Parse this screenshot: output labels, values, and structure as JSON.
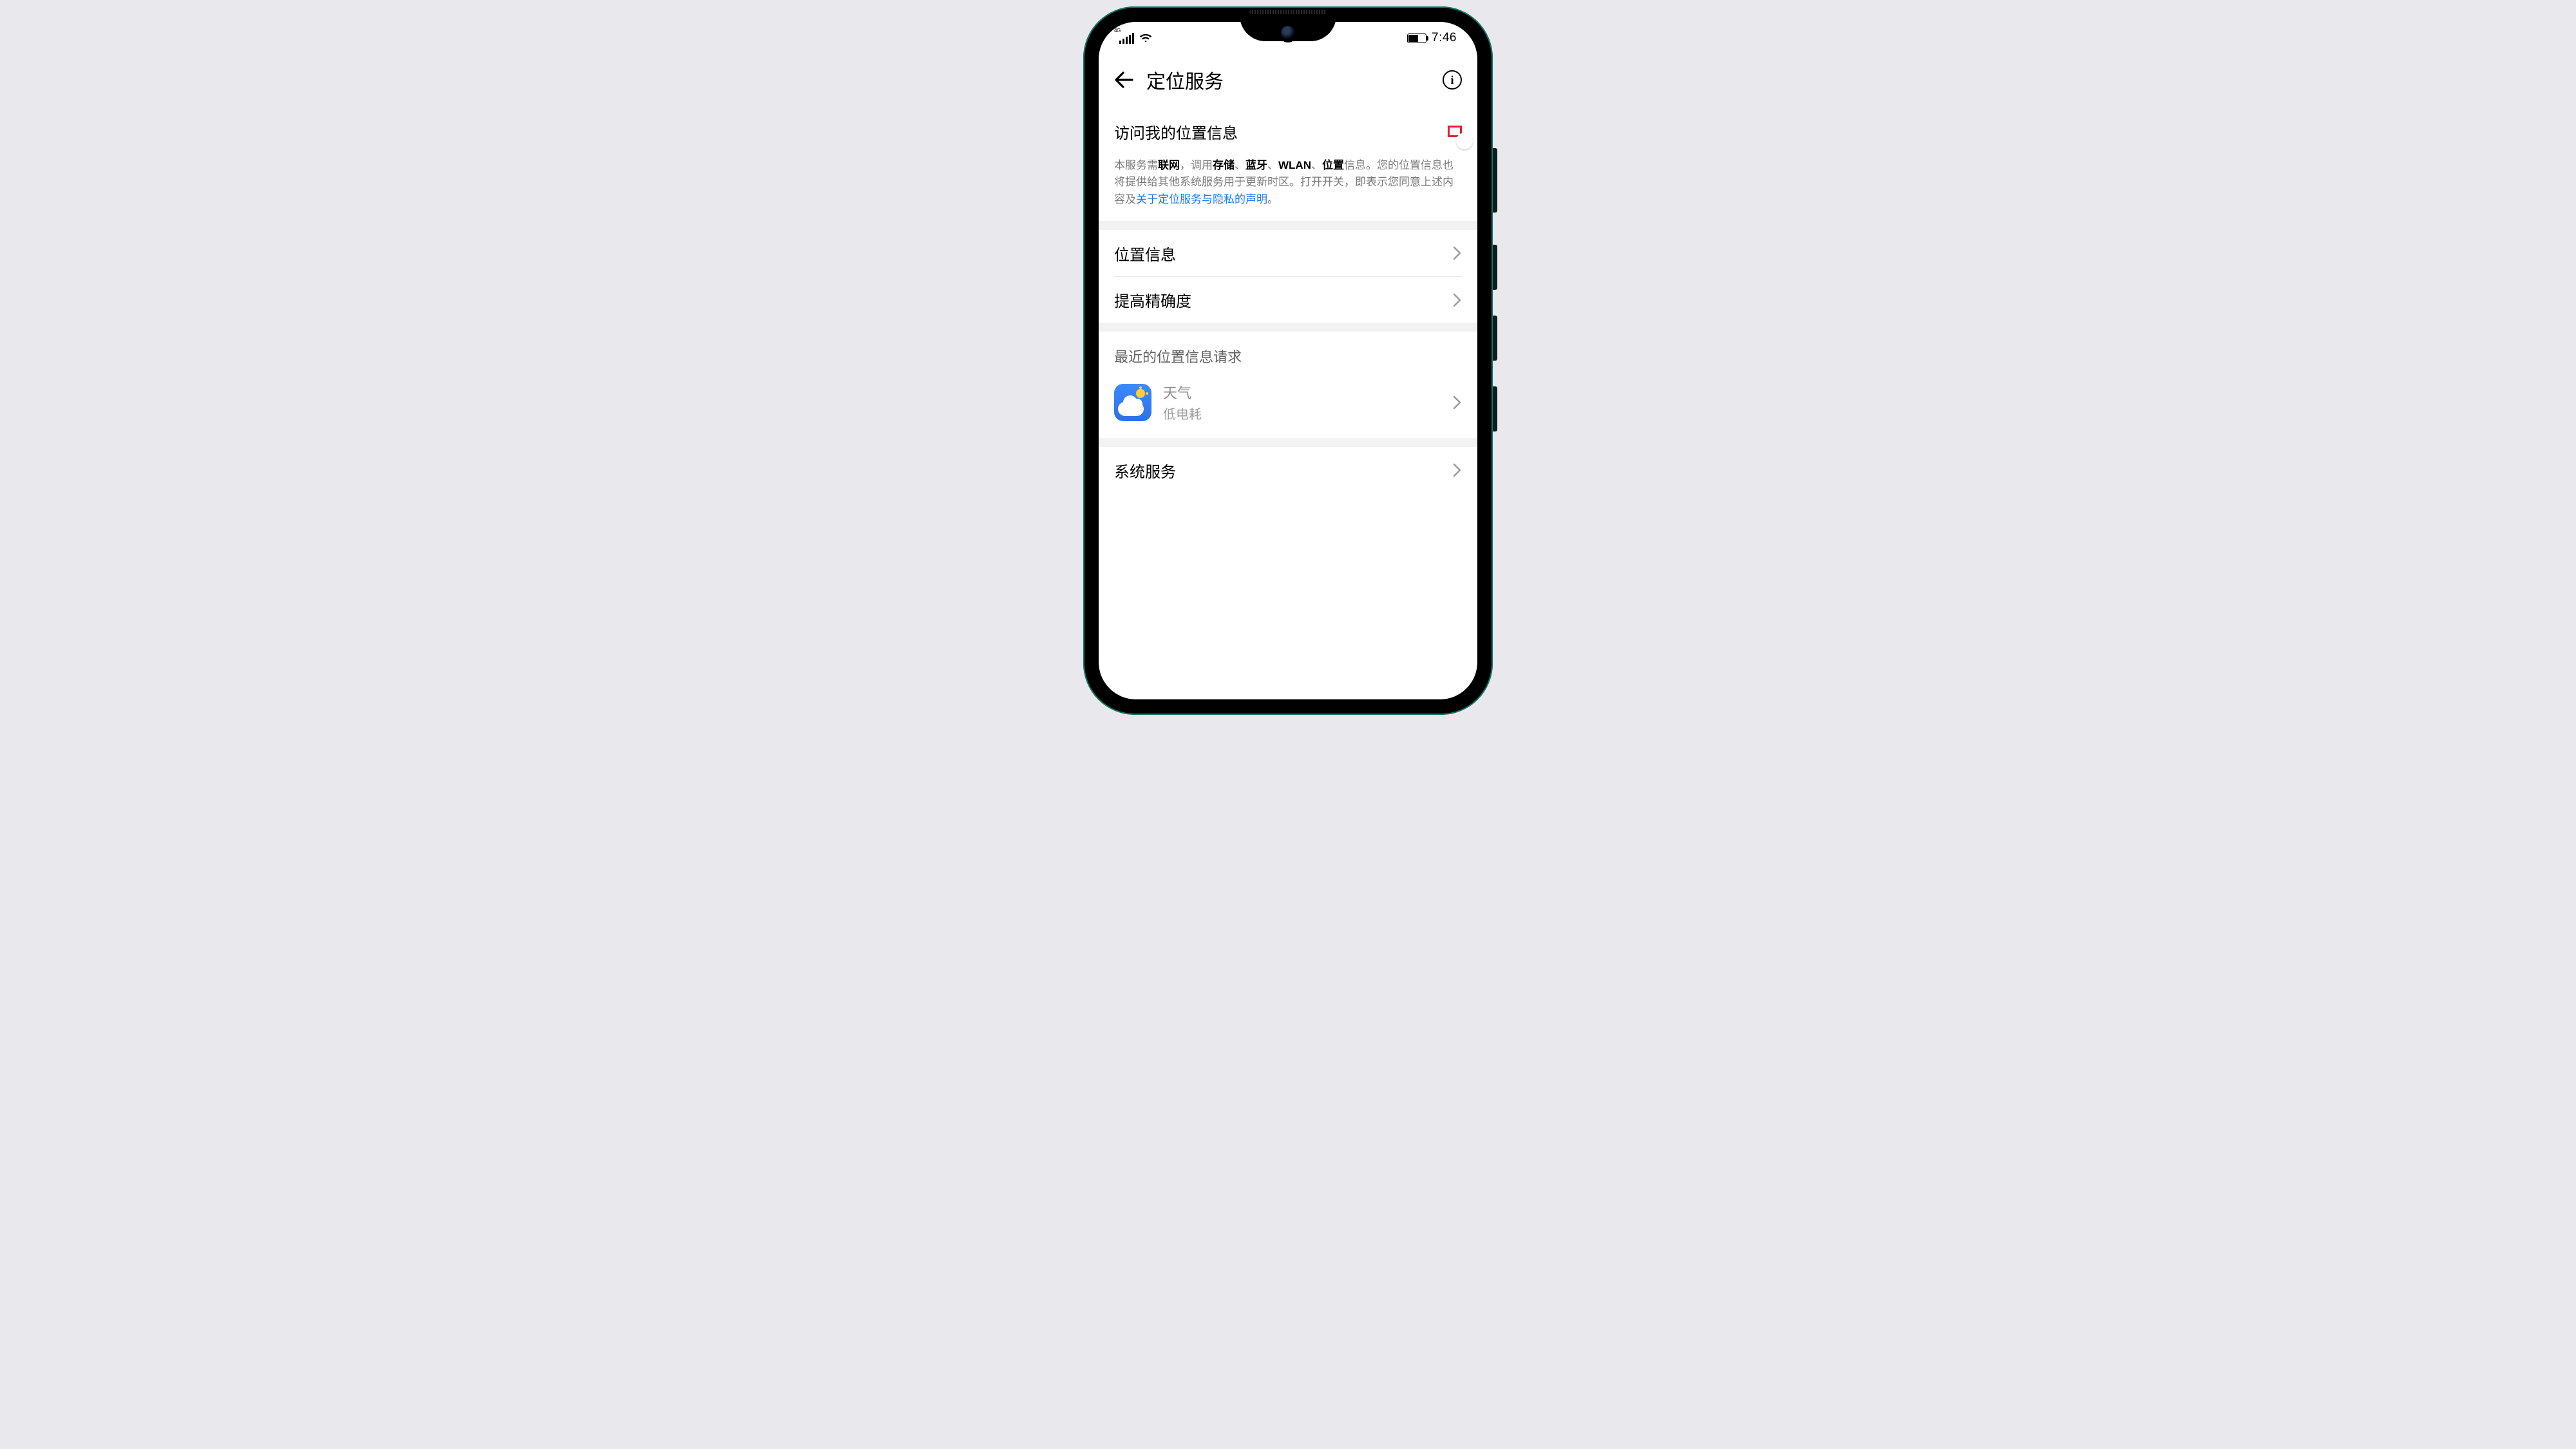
{
  "status": {
    "network_label": "4G",
    "time": "7:46"
  },
  "header": {
    "title": "定位服务"
  },
  "access": {
    "label": "访问我的位置信息",
    "desc_pre": "本服务需",
    "b1": "联网",
    "after_b1": "，调用",
    "b2": "存储",
    "sep1": "、",
    "b3": "蓝牙",
    "sep2": "、",
    "b4": "WLAN",
    "sep3": "、",
    "b5": "位置",
    "after_b5": "信息。您的位置信息也将提供给其他系统服务用于更新时区。打开开关，即表示您同意上述内容及",
    "link": "关于定位服务与隐私的声明",
    "period": "。"
  },
  "rows": {
    "location_info": "位置信息",
    "improve_accuracy": "提高精确度",
    "system_services": "系统服务"
  },
  "recent": {
    "heading": "最近的位置信息请求",
    "app_name": "天气",
    "app_sub": "低电耗"
  }
}
